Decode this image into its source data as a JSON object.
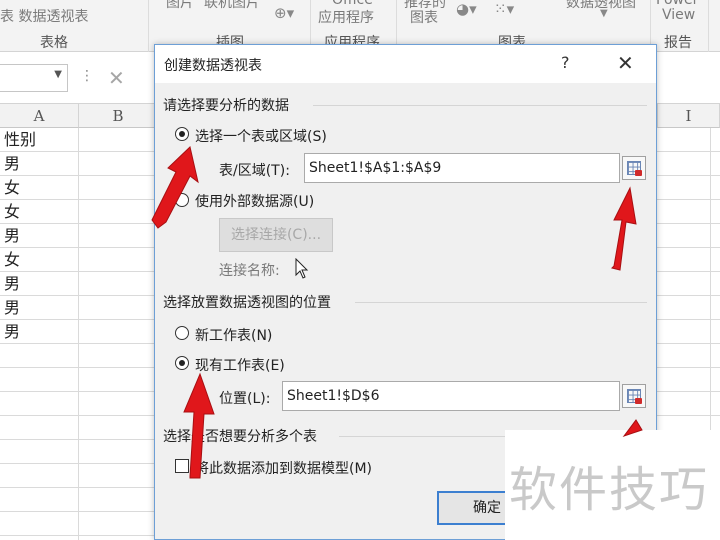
{
  "ribbon": {
    "top_row": [
      "表 数据透视表",
      "图片",
      "联机图片",
      "Office",
      "应用程序",
      "推荐的",
      "图表",
      "数据透视图",
      "Power",
      "View"
    ],
    "groups": [
      "表格",
      "插图",
      "应用程序",
      "图表",
      "报告"
    ]
  },
  "columns": [
    "A",
    "B",
    "I"
  ],
  "cells": [
    "性别",
    "男",
    "女",
    "女",
    "男",
    "女",
    "男",
    "男",
    "男"
  ],
  "dialog": {
    "title": "创建数据透视表",
    "help": "?",
    "close": "✕",
    "section1": "请选择要分析的数据",
    "opt_select_range": "选择一个表或区域(S)",
    "table_range_label": "表/区域(T):",
    "table_range_value": "Sheet1!$A$1:$A$9",
    "opt_external": "使用外部数据源(U)",
    "choose_connection": "选择连接(C)...",
    "connection_name": "连接名称:",
    "section2": "选择放置数据透视图的位置",
    "opt_new_sheet": "新工作表(N)",
    "opt_existing_sheet": "现有工作表(E)",
    "location_label": "位置(L):",
    "location_value": "Sheet1!$D$6",
    "section3": "选择是否想要分析多个表",
    "add_to_model": "将此数据添加到数据模型(M)",
    "ok": "确定",
    "selected_data_option": "选择一个表或区域(S)",
    "selected_location_option": "现有工作表(E)",
    "add_to_model_checked": false
  },
  "watermark": "软件技巧",
  "colors": {
    "dialog_border": "#6d9fd6",
    "arrow_red": "#e0171b",
    "ok_border": "#3c7fd0"
  }
}
